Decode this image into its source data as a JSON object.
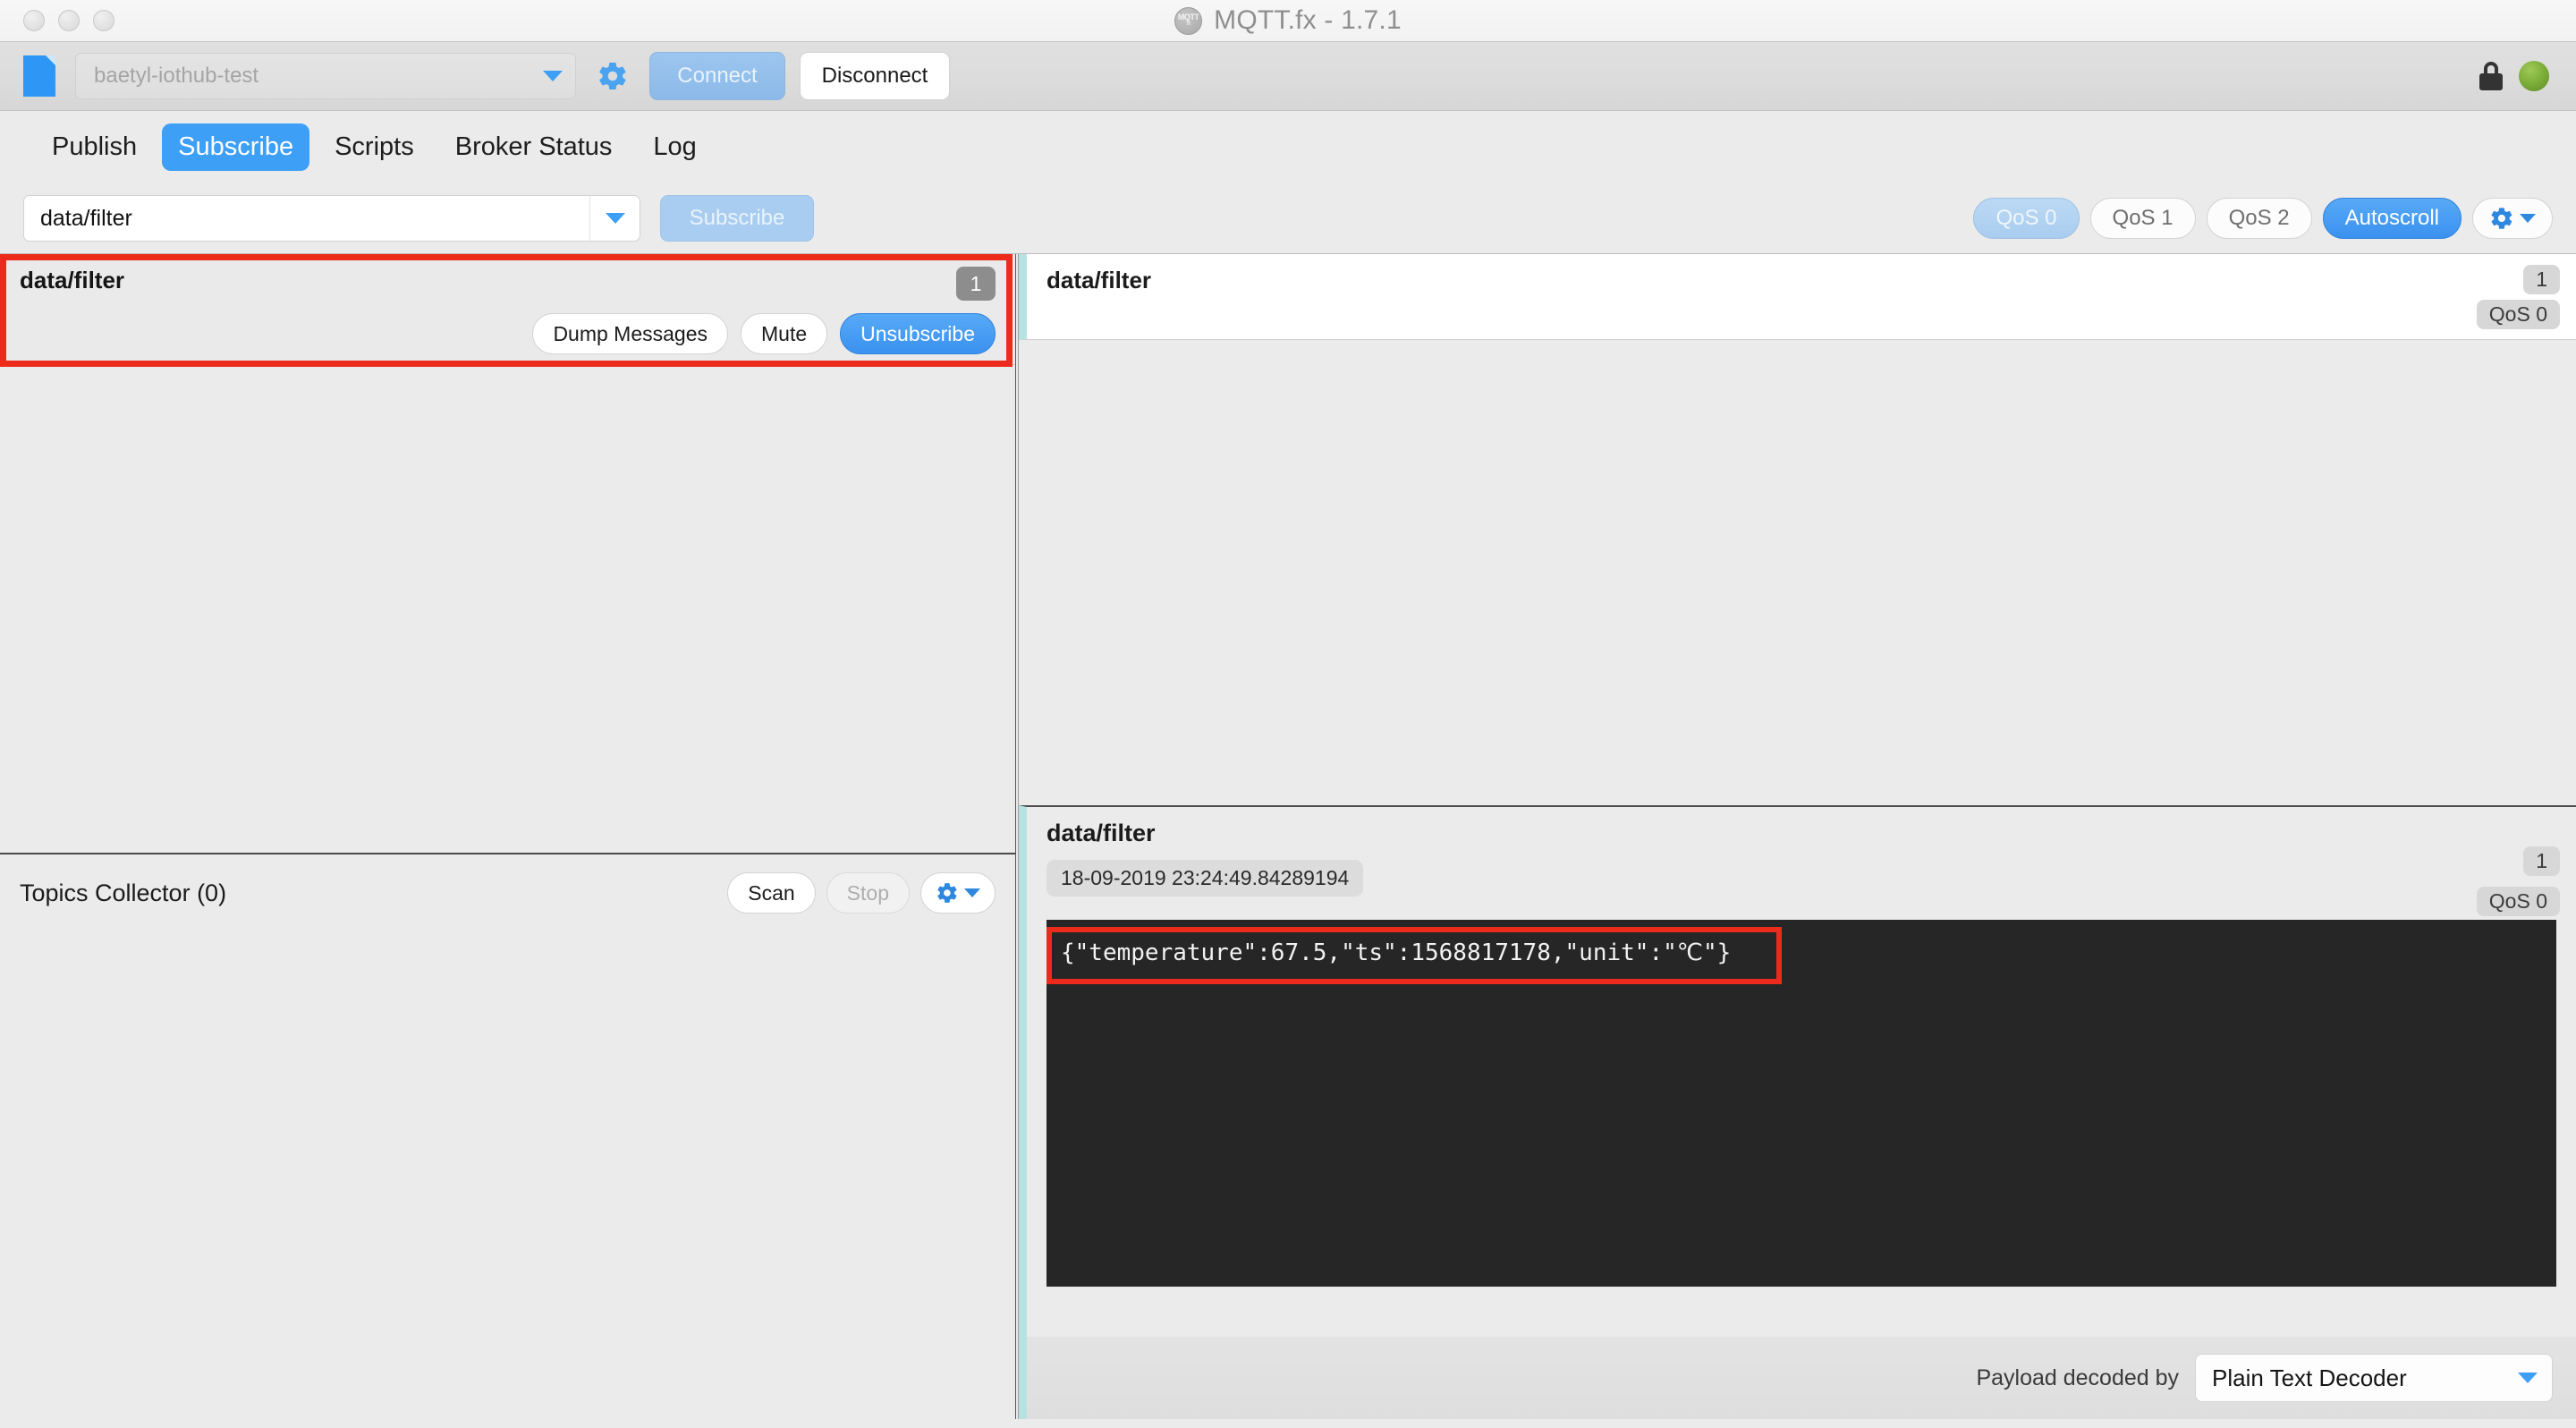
{
  "window": {
    "title": "MQTT.fx - 1.7.1",
    "logo_icon": "mqtt-logo-icon",
    "logo_line1": "MQTT",
    "logo_line2": "fx"
  },
  "connection_bar": {
    "file_icon": "document-icon",
    "profile": "baetyl-iothub-test",
    "profile_caret_icon": "chevron-down-icon",
    "settings_icon": "gear-icon",
    "connect_label": "Connect",
    "disconnect_label": "Disconnect",
    "lock_icon": "lock-icon",
    "status_icon": "green-status-circle",
    "status_color": "#7fb03a"
  },
  "tabs": [
    {
      "label": "Publish",
      "active": false
    },
    {
      "label": "Subscribe",
      "active": true
    },
    {
      "label": "Scripts",
      "active": false
    },
    {
      "label": "Broker Status",
      "active": false
    },
    {
      "label": "Log",
      "active": false
    }
  ],
  "subscribe_toolbar": {
    "topic_value": "data/filter",
    "topic_caret_icon": "chevron-down-icon",
    "subscribe_label": "Subscribe",
    "qos_options": [
      {
        "label": "QoS 0",
        "selected": true
      },
      {
        "label": "QoS 1",
        "selected": false
      },
      {
        "label": "QoS 2",
        "selected": false
      }
    ],
    "autoscroll_label": "Autoscroll",
    "autoscroll_active": true,
    "options_icon": "gear-dropdown-icon"
  },
  "subscriptions": {
    "entry": {
      "topic": "data/filter",
      "count": "1",
      "dump_label": "Dump Messages",
      "mute_label": "Mute",
      "unsubscribe_label": "Unsubscribe",
      "highlighted": true,
      "highlight_color": "#ed2b1c"
    }
  },
  "topics_collector": {
    "label": "Topics Collector (0)",
    "scan_label": "Scan",
    "stop_label": "Stop",
    "options_icon": "gear-dropdown-icon"
  },
  "message_list": {
    "items": [
      {
        "topic": "data/filter",
        "count": "1",
        "qos": "QoS 0"
      }
    ]
  },
  "message_detail": {
    "topic": "data/filter",
    "count": "1",
    "qos": "QoS 0",
    "timestamp": "18-09-2019  23:24:49.84289194",
    "payload": "{\"temperature\":67.5,\"ts\":1568817178,\"unit\":\"℃\"}",
    "payload_highlighted": true,
    "payload_highlight_color": "#ed2b1c",
    "payload_bg": "#262626",
    "decoder_label": "Payload decoded by",
    "decoder_value": "Plain Text Decoder",
    "decoder_caret_icon": "chevron-down-icon"
  }
}
